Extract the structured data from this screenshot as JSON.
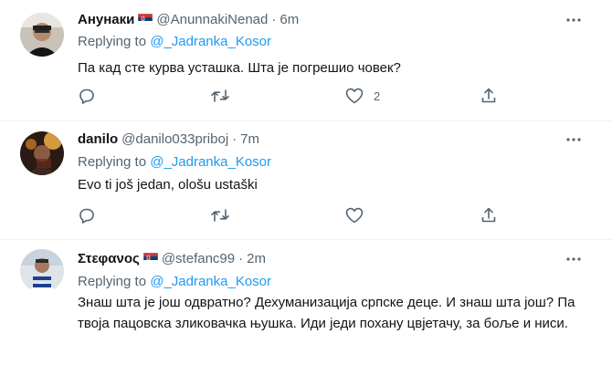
{
  "replying_label": "Replying to",
  "tweets": [
    {
      "name": "Анунаки",
      "handle": "@AnunnakiNenad",
      "separator": "·",
      "time": "6m",
      "replying_to": "@_Jadranka_Kosor",
      "text": "Па кад сте курва усташка. Шта је погрешио човек?",
      "has_flag": true,
      "like_count": "2",
      "icons": [
        "reply-icon",
        "retweet-icon",
        "like-icon",
        "share-icon",
        "more-icon",
        "serbia-flag-icon"
      ]
    },
    {
      "name": "danilo",
      "handle": "@danilo033priboj",
      "separator": "·",
      "time": "7m",
      "replying_to": "@_Jadranka_Kosor",
      "text": "Evo ti još jedan, ološu ustaški",
      "has_flag": false,
      "like_count": "",
      "icons": [
        "reply-icon",
        "retweet-icon",
        "like-icon",
        "share-icon",
        "more-icon"
      ]
    },
    {
      "name": "Στεφανος",
      "handle": "@stefanc99",
      "separator": "·",
      "time": "2m",
      "replying_to": "@_Jadranka_Kosor",
      "text": "Знаш шта је још одвратно? Дехуманизација српске деце. И знаш шта још? Па твоја пацовска зликовачка њушка. Иди једи похану цвјетачу, за боље и ниси.",
      "has_flag": true,
      "like_count": "",
      "icons": [
        "more-icon",
        "serbia-flag-icon"
      ]
    }
  ],
  "colors": {
    "text": "#0f1419",
    "secondary": "#536471",
    "link": "#1d9bf0",
    "divider": "#eff3f4",
    "flag_red": "#c6363c",
    "flag_blue": "#0c4076",
    "flag_white": "#ffffff"
  }
}
